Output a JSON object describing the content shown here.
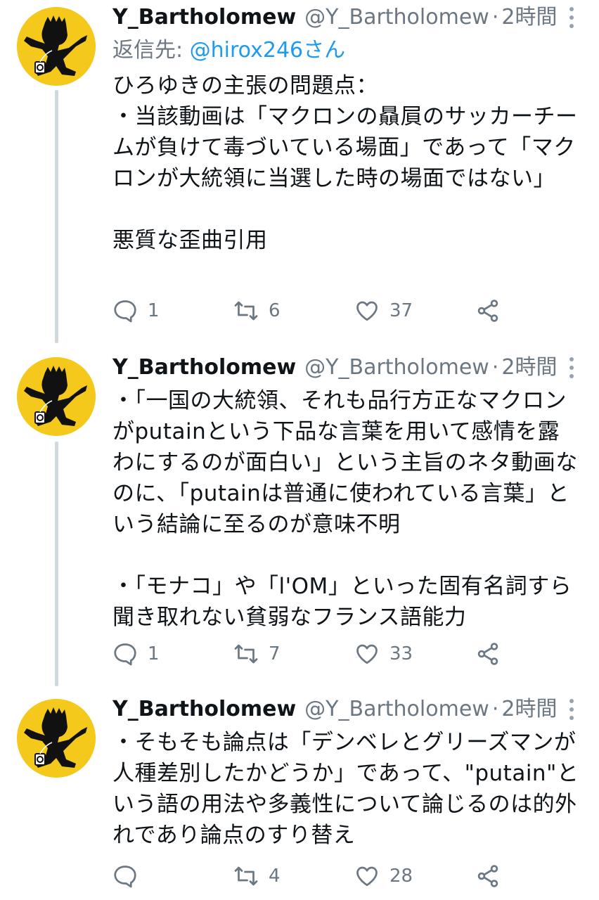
{
  "tweets": [
    {
      "name": "Y_Bartholomew",
      "handle": "@Y_Bartholomew",
      "separator": "·",
      "time": "2時間",
      "reply_prefix": "返信先: ",
      "reply_mention": "@hirox246さん",
      "text": "ひろゆきの主張の問題点：\n・当該動画は「マクロンの贔屓のサッカーチームが負けて毒づいている場面」であって「マクロンが大統領に当選した時の場面ではない」\n\n悪質な歪曲引用",
      "replies": "1",
      "retweets": "6",
      "likes": "37"
    },
    {
      "name": "Y_Bartholomew",
      "handle": "@Y_Bartholomew",
      "separator": "·",
      "time": "2時間",
      "text": "・「一国の大統領、それも品行方正なマクロンがputainという下品な言葉を用いて感情を露わにするのが面白い」という主旨のネタ動画なのに、「putainは普通に使われている言葉」という結論に至るのが意味不明\n\n・「モナコ」や「l'OM」といった固有名詞すら聞き取れない貧弱なフランス語能力",
      "replies": "1",
      "retweets": "7",
      "likes": "33"
    },
    {
      "name": "Y_Bartholomew",
      "handle": "@Y_Bartholomew",
      "separator": "·",
      "time": "2時間",
      "text": "・そもそも論点は「デンベレとグリーズマンが人種差別したかどうか」であって、\"putain\"という語の用法や多義性について論じるのは的外れであり論点のすり替え",
      "replies": "",
      "retweets": "4",
      "likes": "28"
    }
  ],
  "icons": {
    "avatar": "black-silhouette-on-yellow",
    "reply": "speech-bubble-icon",
    "retweet": "retweet-arrows-icon",
    "like": "heart-icon",
    "share": "share-icon",
    "more": "vertical-dots-icon"
  },
  "colors": {
    "text": "#0f1419",
    "secondary": "#6b7782",
    "link": "#1d9bf0",
    "avatar_bg": "#f5c91b",
    "thread_line": "#cfd9de"
  }
}
